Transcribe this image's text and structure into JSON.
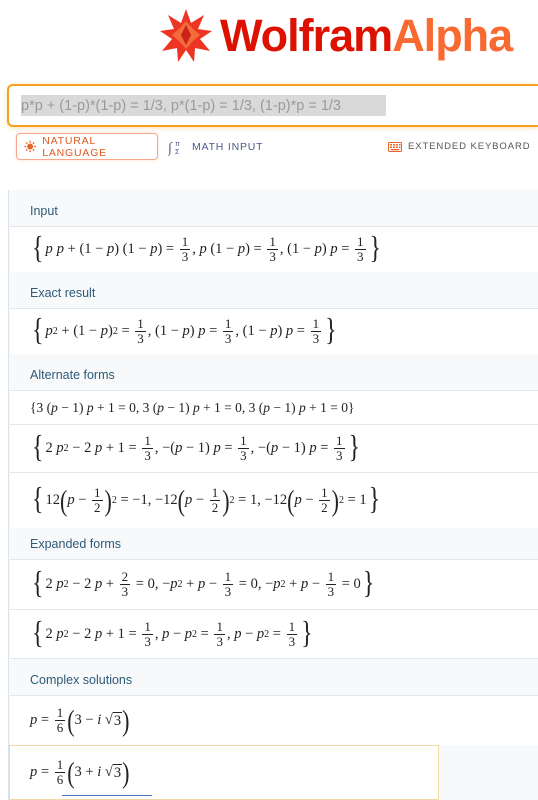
{
  "brand": {
    "word1": "Wolfram",
    "word2": "Alpha",
    "logo_icon": "wolfram-star-icon",
    "primary_color": "#dd1100",
    "secondary_color": "#f96932"
  },
  "search": {
    "value": "p*p + (1-p)*(1-p) = 1/3, p*(1-p) = 1/3, (1-p)*p = 1/3",
    "accent_color": "#f6a11f"
  },
  "modes": {
    "natural_language": "NATURAL LANGUAGE",
    "math_input": "MATH INPUT",
    "extended_keyboard": "EXTENDED KEYBOARD"
  },
  "pods": {
    "input": {
      "title": "Input"
    },
    "exact": {
      "title": "Exact result"
    },
    "alternate": {
      "title": "Alternate forms"
    },
    "expanded": {
      "title": "Expanded forms"
    },
    "complex": {
      "title": "Complex solutions"
    }
  }
}
